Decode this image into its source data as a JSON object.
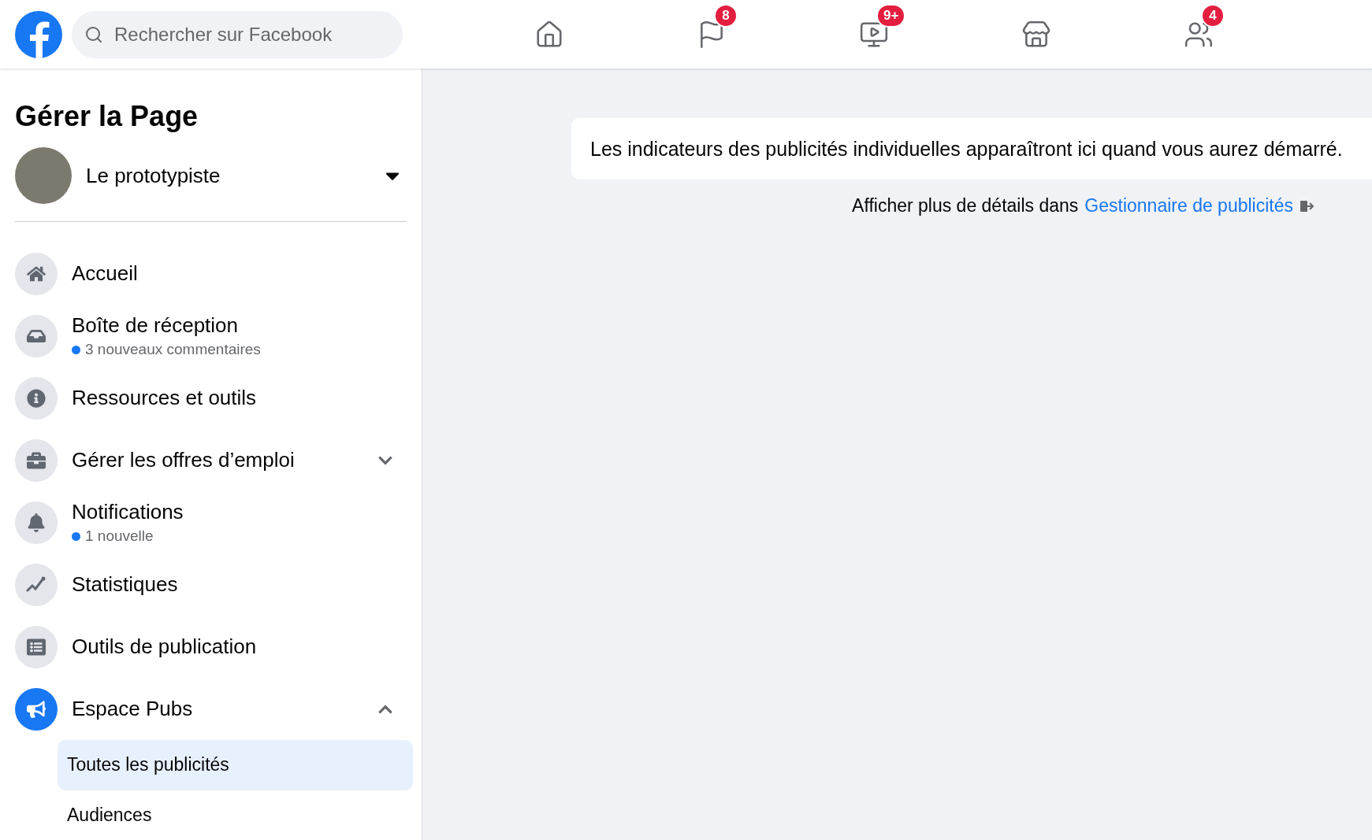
{
  "topbar": {
    "search": {
      "placeholder": "Rechercher sur Facebook"
    },
    "nav": [
      {
        "kind": "home",
        "selected": false
      },
      {
        "kind": "flag",
        "badge": "8",
        "selected": false
      },
      {
        "kind": "video",
        "badge": "9+",
        "selected": false
      },
      {
        "kind": "store",
        "selected": false
      },
      {
        "kind": "groups",
        "badge": "4",
        "selected": false
      }
    ]
  },
  "sidebar": {
    "title": "Gérer la Page",
    "page_name": "Le prototypiste",
    "items": [
      {
        "kind": "home",
        "label": "Accueil",
        "selected": false
      },
      {
        "kind": "inbox",
        "label": "Boîte de réception",
        "subtitle": "3 nouveaux commentaires",
        "selected": false
      },
      {
        "kind": "info",
        "label": "Ressources et outils",
        "selected": false
      },
      {
        "kind": "briefcase",
        "label": "Gérer les offres d’emploi",
        "expanded": false,
        "selected": false
      },
      {
        "kind": "bell",
        "label": "Notifications",
        "subtitle": "1 nouvelle",
        "selected": false
      },
      {
        "kind": "chart",
        "label": "Statistiques",
        "selected": false
      },
      {
        "kind": "publish",
        "label": "Outils de publication",
        "selected": false
      },
      {
        "kind": "megaphone",
        "label": "Espace Pubs",
        "expanded": true,
        "selected": true,
        "children": [
          {
            "label": "Toutes les publicités",
            "selected": true
          },
          {
            "label": "Audiences",
            "selected": false
          }
        ]
      }
    ]
  },
  "main": {
    "message": "Les indicateurs des publicités individuelles apparaîtront ici quand vous aurez démarré.",
    "details_prefix": "Afficher plus de détails dans",
    "details_link": "Gestionnaire de publicités"
  }
}
